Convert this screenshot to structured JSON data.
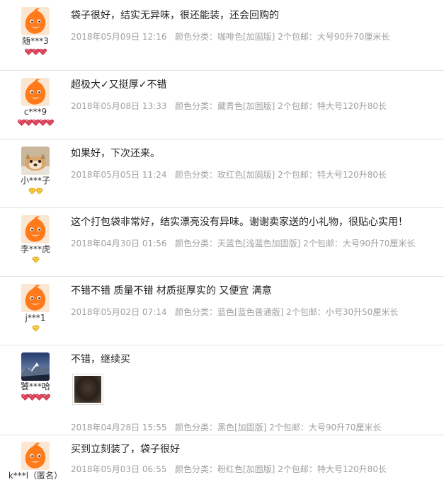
{
  "reviews": [
    {
      "user": "随***3",
      "avatar": "tao-mascot-avatar",
      "rank": {
        "type": "heart",
        "count": 3,
        "color": "#e0465c"
      },
      "text": "袋子很好，结实无异味，很还能装，还会回购的",
      "date": "2018年05月09日 12:16",
      "sku": "颜色分类：咖啡色[加固版]  2个包邮：大号90升70厘米长"
    },
    {
      "user": "c***9",
      "avatar": "tao-mascot-avatar",
      "rank": {
        "type": "heart",
        "count": 5,
        "color": "#e0465c"
      },
      "text": "超极大✓又挺厚✓不错",
      "date": "2018年05月08日 13:33",
      "sku": "颜色分类：藏青色[加固版]  2个包邮：特大号120升80长"
    },
    {
      "user": "小***子",
      "avatar": "dog-photo-avatar",
      "rank": {
        "type": "diamond",
        "count": 2,
        "color": "#f3b70d"
      },
      "text": "如果好，下次还来。",
      "date": "2018年05月05日 11:24",
      "sku": "颜色分类：玫红色[加固版]  2个包邮：特大号120升80长"
    },
    {
      "user": "李***虎",
      "avatar": "tao-mascot-avatar",
      "rank": {
        "type": "diamond",
        "count": 1,
        "color": "#f3b70d"
      },
      "text": "这个打包袋非常好，结实漂亮没有异味。谢谢卖家送的小礼物，很贴心实用！",
      "date": "2018年04月30日 01:56",
      "sku": "颜色分类：天蓝色[浅蓝色加固版]  2个包邮：大号90升70厘米长"
    },
    {
      "user": "j***1",
      "avatar": "tao-mascot-avatar",
      "rank": {
        "type": "diamond",
        "count": 1,
        "color": "#f3b70d"
      },
      "text": "不错不错 质量不错 材质挺厚实的 又便宜 满意",
      "date": "2018年05月02日 07:14",
      "sku": "颜色分类：蓝色[蓝色普通版]  2个包邮：小号30升50厘米长"
    },
    {
      "user": "饕***哈",
      "avatar": "mountain-photo-avatar",
      "rank": {
        "type": "heart",
        "count": 4,
        "color": "#e0465c"
      },
      "text": "不错，继续买",
      "date": "2018年04月28日 15:55",
      "sku": "颜色分类：黑色[加固版]  2个包邮：大号90升70厘米长"
    },
    {
      "user": "k***l（匿名）",
      "avatar": "tao-mascot-avatar",
      "rank": {
        "type": "none",
        "count": 0,
        "color": ""
      },
      "text": "买到立刻装了，袋子很好",
      "date": "2018年05月03日 06:55",
      "sku": "颜色分类：粉红色[加固版]  2个包邮：特大号120升80长"
    }
  ]
}
